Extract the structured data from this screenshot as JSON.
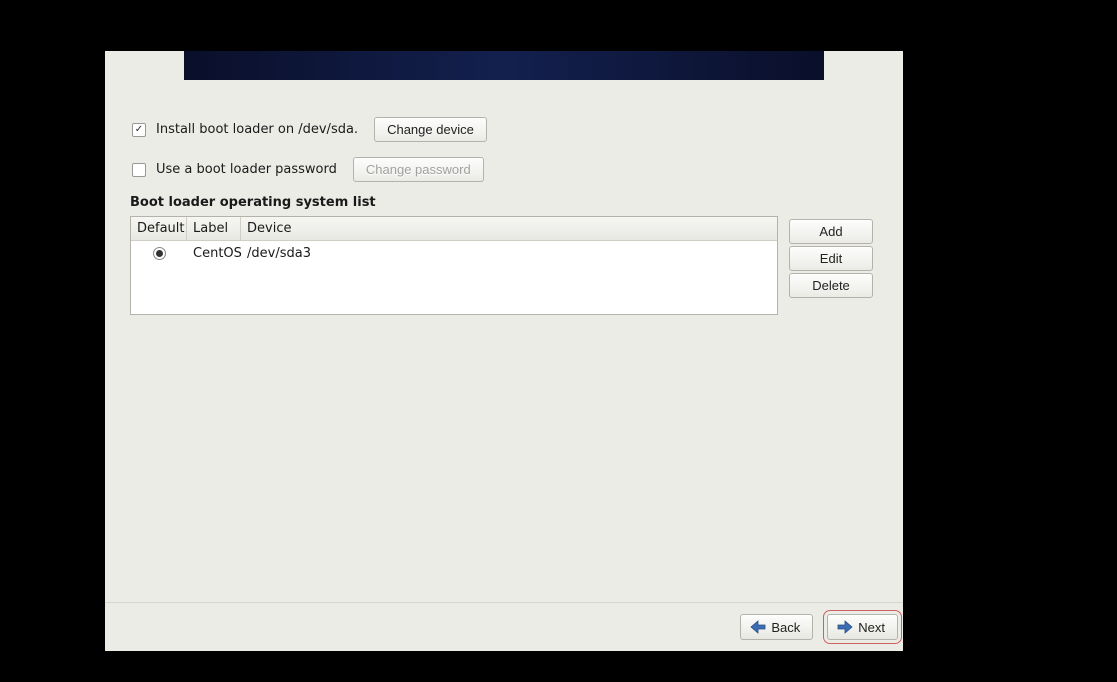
{
  "install_row": {
    "checked": true,
    "label": "Install boot loader on /dev/sda.",
    "button": "Change device"
  },
  "password_row": {
    "checked": false,
    "label": "Use a boot loader password",
    "button": "Change password"
  },
  "section_title": "Boot loader operating system list",
  "table": {
    "headers": {
      "default": "Default",
      "label": "Label",
      "device": "Device"
    },
    "rows": [
      {
        "default_selected": true,
        "label": "CentOS",
        "device": "/dev/sda3"
      }
    ]
  },
  "side_buttons": {
    "add": "Add",
    "edit": "Edit",
    "delete": "Delete"
  },
  "footer": {
    "back": "Back",
    "next": "Next"
  }
}
